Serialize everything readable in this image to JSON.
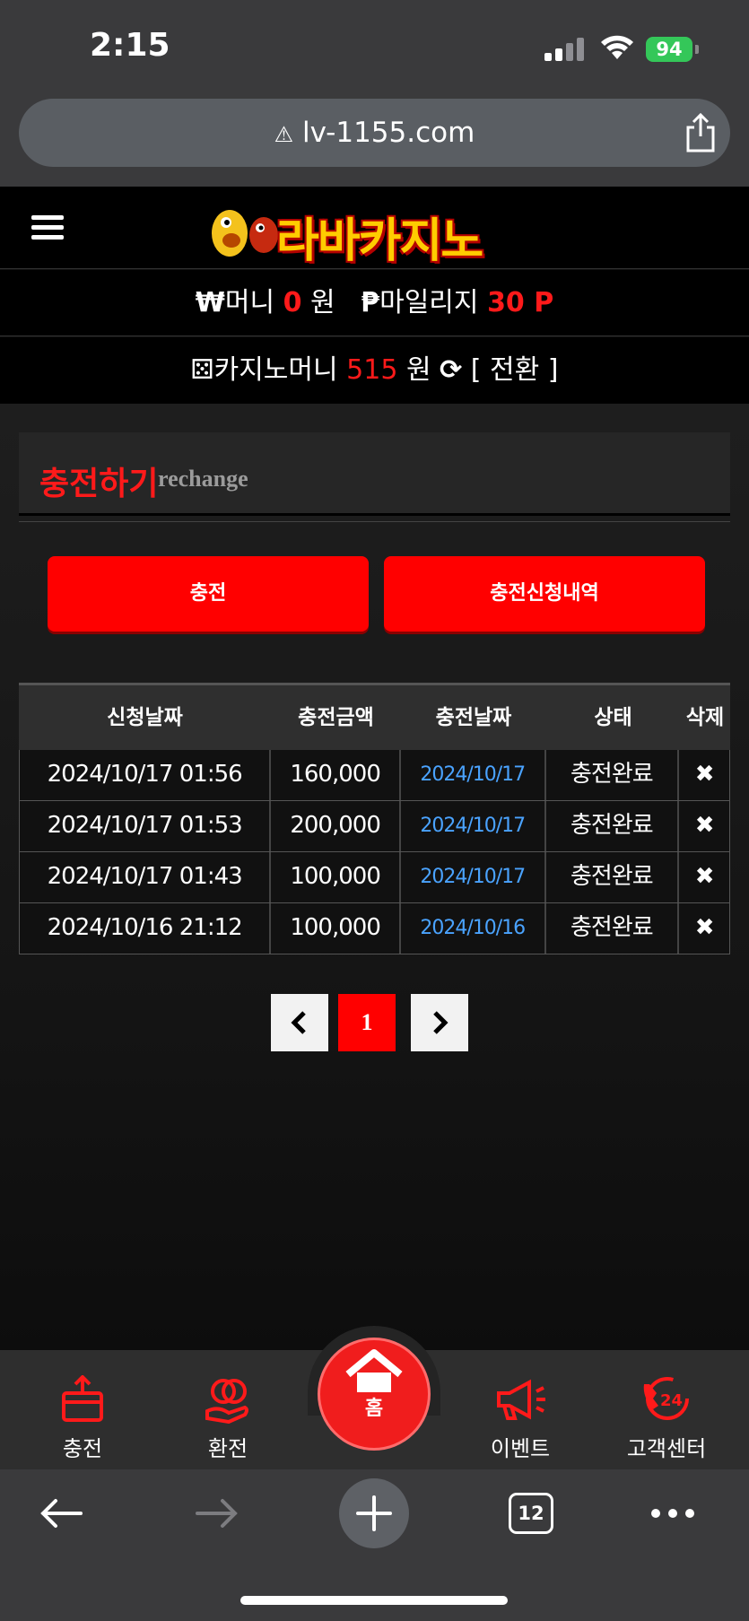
{
  "status_bar": {
    "time": "2:15",
    "battery": "94"
  },
  "browser": {
    "url": "lv-1155.com",
    "tab_count": "12"
  },
  "header": {
    "logo_text": "라바카지노"
  },
  "wallet": {
    "money_label": "머니",
    "money_value": "0",
    "money_unit": "원",
    "mileage_label": "마일리지",
    "mileage_value": "30 P",
    "casino_label": "카지노머니",
    "casino_value": "515",
    "casino_unit": "원",
    "convert_label": "[ 전환 ]"
  },
  "page": {
    "title_ko": "충전하기",
    "title_en": "rechange"
  },
  "actions": {
    "charge_label": "충전",
    "history_label": "충전신청내역"
  },
  "table": {
    "headers": [
      "신청날짜",
      "충전금액",
      "충전날짜",
      "상태",
      "삭제"
    ],
    "rows": [
      {
        "request_date": "2024/10/17 01:56",
        "amount": "160,000",
        "charge_date": "2024/10/17",
        "status": "충전완료"
      },
      {
        "request_date": "2024/10/17 01:53",
        "amount": "200,000",
        "charge_date": "2024/10/17",
        "status": "충전완료"
      },
      {
        "request_date": "2024/10/17 01:43",
        "amount": "100,000",
        "charge_date": "2024/10/17",
        "status": "충전완료"
      },
      {
        "request_date": "2024/10/16 21:12",
        "amount": "100,000",
        "charge_date": "2024/10/16",
        "status": "충전완료"
      }
    ]
  },
  "pagination": {
    "current": "1"
  },
  "bottom_nav": {
    "charge": "충전",
    "exchange": "환전",
    "home": "홈",
    "event": "이벤트",
    "support": "고객센터"
  },
  "colors": {
    "accent": "#ff0000",
    "link": "#4aa3ff",
    "background": "#111111"
  }
}
